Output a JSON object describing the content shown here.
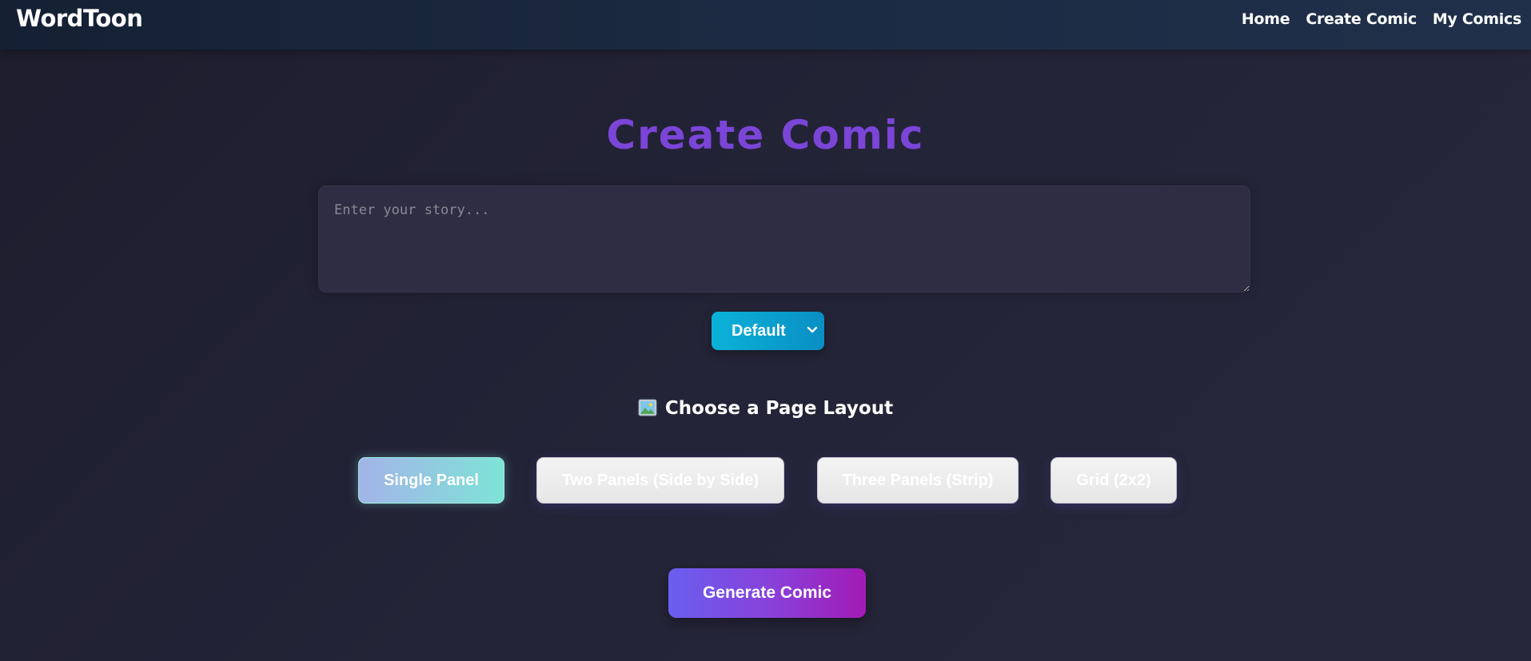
{
  "navbar": {
    "brand": "WordToon",
    "links": [
      {
        "label": "Home"
      },
      {
        "label": "Create Comic"
      },
      {
        "label": "My Comics"
      }
    ]
  },
  "main": {
    "title": "Create Comic",
    "story_input": {
      "placeholder": "Enter your story...",
      "value": ""
    },
    "style_select": {
      "selected": "Default"
    },
    "layout_section": {
      "heading": "Choose a Page Layout",
      "icon": "framed-picture-icon",
      "options": [
        {
          "label": "Single Panel",
          "selected": true
        },
        {
          "label": "Two Panels (Side by Side)",
          "selected": false
        },
        {
          "label": "Three Panels (Strip)",
          "selected": false
        },
        {
          "label": "Grid (2x2)",
          "selected": false
        }
      ]
    },
    "generate_label": "Generate Comic"
  },
  "colors": {
    "title": "#7b45d8",
    "select_accent": "#0bb2d8",
    "generate_start": "#6a5ef0",
    "generate_end": "#a21bb4",
    "active_layout_start": "#a3b4e8",
    "active_layout_end": "#7ee3d6"
  }
}
